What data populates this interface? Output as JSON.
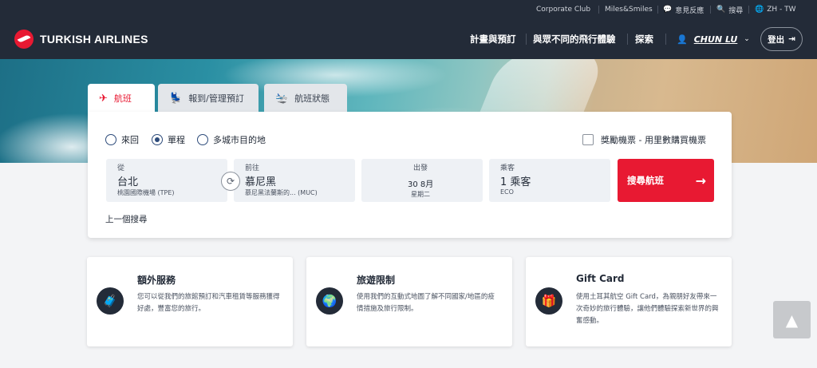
{
  "topbar": {
    "corporate": "Corporate Club",
    "miles": "Miles&Smiles",
    "feedback": "意見反應",
    "search": "搜尋",
    "language": "ZH - TW"
  },
  "header": {
    "brand": "TURKISH AIRLINES",
    "nav": [
      "計畫與預訂",
      "與眾不同的飛行體驗",
      "探索"
    ],
    "user_name": "CHUN LU",
    "logout": "登出"
  },
  "tabs": [
    {
      "label": "航班"
    },
    {
      "label": "報到/管理預訂"
    },
    {
      "label": "航班狀態"
    }
  ],
  "trip_type": {
    "options": [
      "來回",
      "單程",
      "多城市目的地"
    ],
    "selected": "單程"
  },
  "award": {
    "label": "獎勵機票 - 用里數購買機票"
  },
  "search_form": {
    "from": {
      "label": "從",
      "city": "台北",
      "airport": "桃園國際機場 (TPE)"
    },
    "to": {
      "label": "前往",
      "city": "慕尼黑",
      "airport": "慕尼黑法蘭斯的... (MUC)"
    },
    "date": {
      "label": "出發",
      "day": "30",
      "month": "8月",
      "weekday": "星期二"
    },
    "passengers": {
      "label": "乘客",
      "count": "1 乘客",
      "cabin": "ECO"
    },
    "search_button": "搜尋航班",
    "previous_search": "上一個搜尋"
  },
  "info_cards": [
    {
      "title": "額外服務",
      "desc": "您可以從我們的旅館預訂和汽車租賃等服務獲得好處，豐富您的旅行。"
    },
    {
      "title": "旅遊限制",
      "desc": "使用我們的互動式地圖了解不同國家/地區的疫情措施及旅行限制。"
    },
    {
      "title": "Gift Card",
      "desc": "使用土耳其航空 Gift Card，為親朋好友帶來一次奇妙的旅行體驗，讓他們體驗探索新世界的興奮感動。"
    }
  ],
  "icons": {
    "chat": "chat-icon",
    "search": "search-icon",
    "globe": "globe-icon",
    "user": "user-icon",
    "logout": "logout-icon",
    "plane": "plane-icon",
    "seat": "seat-icon",
    "status": "status-icon",
    "swap": "swap-icon",
    "arrow": "arrow-right-icon",
    "luggage": "luggage-icon",
    "world": "world-icon",
    "gift": "gift-icon",
    "top": "chevron-up-icon"
  },
  "colors": {
    "header_bg": "#232b38",
    "brand_red": "#e81932",
    "field_bg": "#eef1f5",
    "page_bg": "#f3f4f6"
  }
}
